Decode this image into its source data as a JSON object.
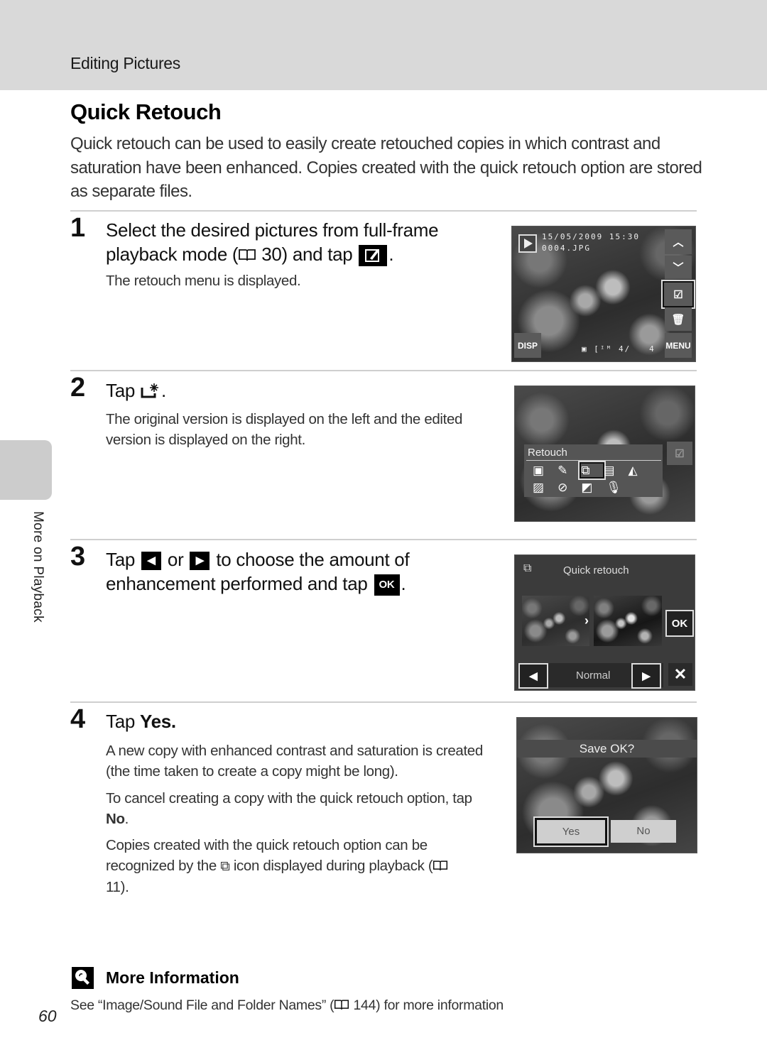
{
  "header": {
    "section": "Editing Pictures"
  },
  "page_title": "Quick Retouch",
  "intro": "Quick retouch can be used to easily create retouched copies in which contrast and saturation have been enhanced. Copies created with the quick retouch option are stored as separate files.",
  "side_tab": {
    "label": "More on Playback"
  },
  "steps": [
    {
      "number": "1",
      "title_a": "Select the desired pictures from full-frame playback mode (",
      "title_ref": "30",
      "title_b": ") and tap",
      "title_icon": "retouch-icon",
      "body": [
        "The retouch menu is displayed."
      ],
      "screen": {
        "date": "15/05/2009 15:30",
        "file": "0004.JPG",
        "disp": "DISP",
        "menu": "MENU",
        "counter": "4/   4",
        "buttons": [
          "up-arrow-icon",
          "down-arrow-icon",
          "retouch-icon",
          "delete-icon"
        ]
      }
    },
    {
      "number": "2",
      "title_a": "Tap",
      "title_icon": "quick-retouch-icon",
      "title_b": ".",
      "body": [
        "The original version is displayed on the left and the edited version is displayed on the right."
      ],
      "screen": {
        "menu_title": "Retouch",
        "icons_row1": [
          "d-lighting-icon",
          "paint-icon",
          "quick-retouch-icon",
          "small-picture-icon",
          "crop-icon"
        ],
        "icons_row2": [
          "skin-softening-icon",
          "filter-icon",
          "crop-small-icon",
          "voice-memo-icon"
        ],
        "selected": "quick-retouch-icon"
      }
    },
    {
      "number": "3",
      "title_a": "Tap",
      "title_left_icon": "left-arrow-icon",
      "title_mid": "or",
      "title_right_icon": "right-arrow-icon",
      "title_b": "to choose the amount of enhancement performed and tap",
      "title_ok": "OK",
      "body": [],
      "screen": {
        "title": "Quick retouch",
        "level": "Normal",
        "ok": "OK",
        "close": "close-icon"
      }
    },
    {
      "number": "4",
      "title_a": "Tap",
      "title_bold": "Yes",
      "title_b": ".",
      "body_1": "A new copy with enhanced contrast and saturation is created (the time taken to create a copy might be long).",
      "body_2a": "To cancel creating a copy with the quick retouch option, tap",
      "body_2b": "No",
      "body_2c": ".",
      "body_3a": "Copies created with the quick retouch option can be recognized by the",
      "body_3b": "icon displayed during playback (",
      "body_3ref": "11",
      "body_3c": ").",
      "screen": {
        "prompt": "Save OK?",
        "yes": "Yes",
        "no": "No"
      }
    }
  ],
  "more_info": {
    "title": "More Information",
    "text_a": "See “Image/Sound File and Folder Names” (",
    "ref": "144",
    "text_b": ") for more information"
  },
  "page_number": "60"
}
